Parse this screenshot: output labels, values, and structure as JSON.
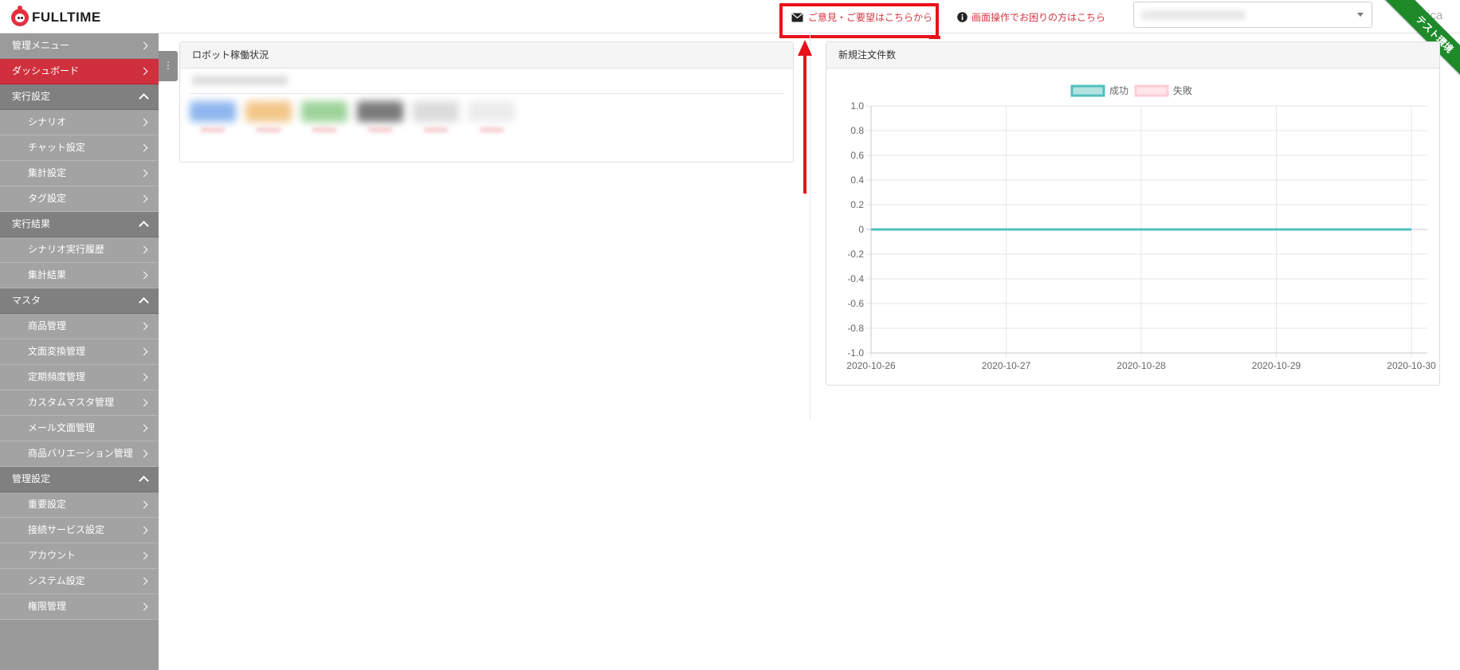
{
  "header": {
    "logo_text": "FULLTIME",
    "feedback_label": "ご意見・ご要望はこちらから",
    "help_label": "画面操作でお困りの方はこちら",
    "user_name": "asnica",
    "env_ribbon": "テスト環境"
  },
  "sidebar": {
    "items": [
      {
        "label": "管理メニュー",
        "kind": "item"
      },
      {
        "label": "ダッシュボード",
        "kind": "active"
      },
      {
        "label": "実行設定",
        "kind": "section"
      },
      {
        "label": "シナリオ",
        "kind": "sub"
      },
      {
        "label": "チャット設定",
        "kind": "sub"
      },
      {
        "label": "集計設定",
        "kind": "sub"
      },
      {
        "label": "タグ設定",
        "kind": "sub"
      },
      {
        "label": "実行結果",
        "kind": "section"
      },
      {
        "label": "シナリオ実行履歴",
        "kind": "sub"
      },
      {
        "label": "集計結果",
        "kind": "sub"
      },
      {
        "label": "マスタ",
        "kind": "section"
      },
      {
        "label": "商品管理",
        "kind": "sub"
      },
      {
        "label": "文面変換管理",
        "kind": "sub"
      },
      {
        "label": "定期頻度管理",
        "kind": "sub"
      },
      {
        "label": "カスタムマスタ管理",
        "kind": "sub"
      },
      {
        "label": "メール文面管理",
        "kind": "sub"
      },
      {
        "label": "商品バリエーション管理",
        "kind": "sub"
      },
      {
        "label": "管理設定",
        "kind": "section"
      },
      {
        "label": "重要設定",
        "kind": "sub"
      },
      {
        "label": "接続サービス設定",
        "kind": "sub"
      },
      {
        "label": "アカウント",
        "kind": "sub"
      },
      {
        "label": "システム設定",
        "kind": "sub"
      },
      {
        "label": "権限管理",
        "kind": "sub"
      }
    ],
    "toggle_glyph": "⋮"
  },
  "robot_panel": {
    "title": "ロボット稼働状況",
    "chip_colors": [
      "#8fb7ef",
      "#f3c68a",
      "#9ed39a",
      "#7a7a7a",
      "#dcdcdc",
      "#ececec"
    ]
  },
  "chart_panel": {
    "title": "新規注文件数"
  },
  "chart_data": {
    "type": "line",
    "x": [
      "2020-10-26",
      "2020-10-27",
      "2020-10-28",
      "2020-10-29",
      "2020-10-30"
    ],
    "series": [
      {
        "name": "成功",
        "values": [
          0,
          0,
          0,
          0,
          0
        ],
        "color": "#4fc0bf",
        "fill": "#b3e2e1"
      },
      {
        "name": "失敗",
        "values": [],
        "color": "#ffccd5",
        "fill": "#ffe4e9"
      }
    ],
    "ylim": [
      -1.0,
      1.0
    ],
    "yticks": [
      "1.0",
      "0.8",
      "0.6",
      "0.4",
      "0.2",
      "0",
      "-0.2",
      "-0.4",
      "-0.6",
      "-0.8",
      "-1.0"
    ],
    "grid": true,
    "legend": "top-center"
  },
  "colors": {
    "accent": "#d0303d",
    "highlight": "#e8111b",
    "ribbon": "#1e8a2a"
  }
}
